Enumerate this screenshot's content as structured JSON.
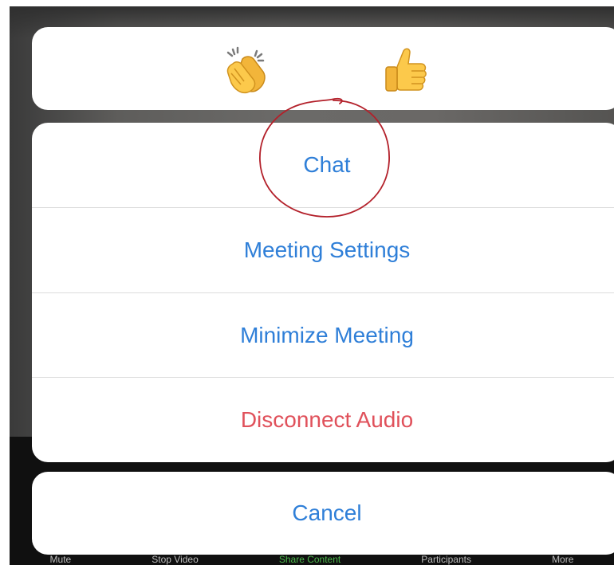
{
  "toolbar": {
    "items": [
      "Mute",
      "Stop Video",
      "Share Content",
      "Participants",
      "More"
    ]
  },
  "reactions": {
    "clap": {
      "icon": "clapping-hands-icon"
    },
    "thumbs_up": {
      "icon": "thumbs-up-icon"
    }
  },
  "menu": {
    "items": [
      {
        "label": "Chat",
        "style": "default"
      },
      {
        "label": "Meeting Settings",
        "style": "default"
      },
      {
        "label": "Minimize Meeting",
        "style": "default"
      },
      {
        "label": "Disconnect Audio",
        "style": "destructive"
      }
    ]
  },
  "cancel_label": "Cancel",
  "colors": {
    "action_blue": "#2f7fd8",
    "destructive_red": "#e0515b",
    "annotation_red": "#b3202a"
  }
}
